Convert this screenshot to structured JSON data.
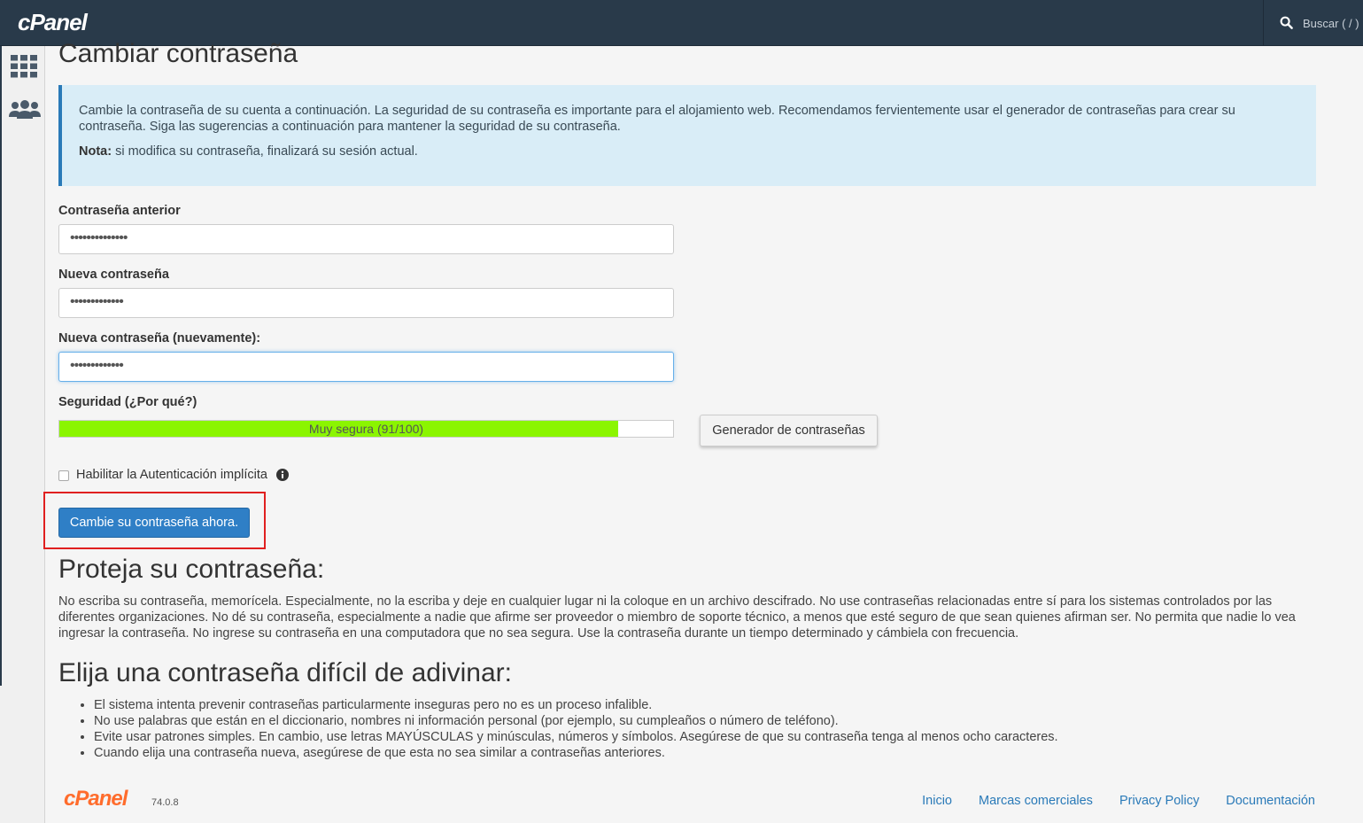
{
  "topbar": {
    "brand": "cPanel",
    "search_placeholder": "Buscar ( / )",
    "search_icon": "search-icon"
  },
  "sidebar": {
    "items": [
      {
        "icon": "grid-icon"
      },
      {
        "icon": "users-icon"
      }
    ]
  },
  "page": {
    "title": "Cambiar contraseña",
    "alert_text": "Cambie la contraseña de su cuenta a continuación. La seguridad de su contraseña es importante para el alojamiento web. Recomendamos fervientemente usar el generador de contraseñas para crear su contraseña. Siga las sugerencias a continuación para mantener la seguridad de su contraseña.",
    "alert_note_label": "Nota:",
    "alert_note_text": " si modifica su contraseña, finalizará su sesión actual."
  },
  "form": {
    "old_label": "Contraseña anterior",
    "old_value": "••••••••••••••",
    "new_label": "Nueva contraseña",
    "new_value": "•••••••••••••",
    "confirm_label": "Nueva contraseña (nuevamente):",
    "confirm_value": "•••••••••••••",
    "strength_label": "Seguridad (¿Por qué?)",
    "strength_text": "Muy segura (91/100)",
    "strength_value": 91,
    "strength_color": "#8bf500",
    "generator_button": "Generador de contraseñas",
    "digest_label": "Habilitar la Autenticación implícita",
    "digest_checked": false,
    "submit_button": "Cambie su contraseña ahora."
  },
  "protect": {
    "title": "Proteja su contraseña:",
    "text": "No escriba su contraseña, memorícela. Especialmente, no la escriba y deje en cualquier lugar ni la coloque en un archivo descifrado. No use contraseñas relacionadas entre sí para los sistemas controlados por las diferentes organizaciones. No dé su contraseña, especialmente a nadie que afirme ser proveedor o miembro de soporte técnico, a menos que esté seguro de que sean quienes afirman ser. No permita que nadie lo vea ingresar la contraseña. No ingrese su contraseña en una computadora que no sea segura. Use la contraseña durante un tiempo determinado y cámbiela con frecuencia."
  },
  "choose": {
    "title": "Elija una contraseña difícil de adivinar:",
    "tips": [
      "El sistema intenta prevenir contraseñas particularmente inseguras pero no es un proceso infalible.",
      "No use palabras que están en el diccionario, nombres ni información personal (por ejemplo, su cumpleaños o número de teléfono).",
      "Evite usar patrones simples. En cambio, use letras MAYÚSCULAS y minúsculas, números y símbolos. Asegúrese de que su contraseña tenga al menos ocho caracteres.",
      "Cuando elija una contraseña nueva, asegúrese de que esta no sea similar a contraseñas anteriores."
    ]
  },
  "footer": {
    "brand": "cPanel",
    "version": "74.0.8",
    "links": [
      "Inicio",
      "Marcas comerciales",
      "Privacy Policy",
      "Documentación"
    ]
  }
}
